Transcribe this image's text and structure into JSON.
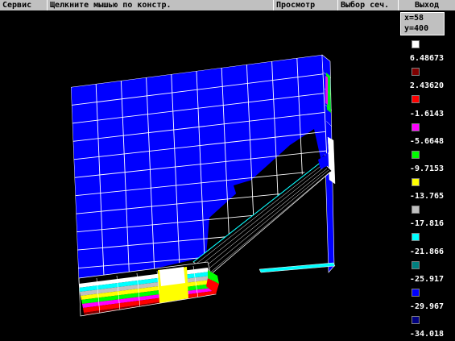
{
  "menu": {
    "service": "Сервис",
    "hint": "Щелкните мышью по констр.",
    "view": "Просмотр",
    "section": "Выбор сеч.",
    "exit": "Выход"
  },
  "coords": {
    "x": "x=58",
    "y": "y=400"
  },
  "legend": {
    "items": [
      {
        "label": "",
        "color": "#ffffff"
      },
      {
        "label": "6.48673",
        "color": "#800000"
      },
      {
        "label": "2.43620",
        "color": "#ff0000"
      },
      {
        "label": "-1.6143",
        "color": "#ff00ff"
      },
      {
        "label": "-5.6648",
        "color": "#00ff00"
      },
      {
        "label": "-9.7153",
        "color": "#ffff00"
      },
      {
        "label": "-13.765",
        "color": "#c0c0c0"
      },
      {
        "label": "-17.816",
        "color": "#00ffff"
      },
      {
        "label": "-21.866",
        "color": "#008080"
      },
      {
        "label": "-25.917",
        "color": "#0000ff"
      },
      {
        "label": "-29.967",
        "color": "#000080"
      },
      {
        "label": "-34.018",
        "color": ""
      }
    ]
  }
}
